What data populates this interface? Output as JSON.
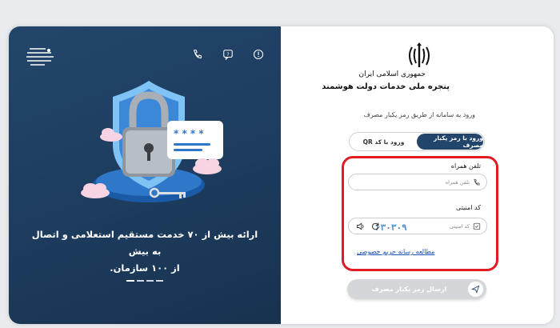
{
  "left_panel": {
    "tagline_line1": "ارائه بیش از ۷۰ خدمت مستقیم استعلامی و اتصال به بیش",
    "tagline_line2": "از ۱۰۰ سازمان.",
    "slider": {
      "slide_count": 4,
      "active_index": 0
    },
    "icons": [
      "info-icon",
      "chat-icon",
      "phone-icon",
      "globe-logo-icon"
    ]
  },
  "header": {
    "gov_name": "جمهوری اسلامی ایران",
    "portal_name": "پنجره ملی خدمات دولت هوشمند",
    "intro": "ورود به سامانه از طریق رمز یکبار مصرف"
  },
  "tabs": [
    {
      "label": "ورود با رمز یکبار مصرف",
      "active": true
    },
    {
      "label": "ورود با کد QR",
      "active": false
    }
  ],
  "form": {
    "phone_label": "تلفن همراه",
    "phone_placeholder": "تلفن همراه",
    "security_label": "کد امنیتی",
    "security_placeholder": "کد امنیتی",
    "captcha_text": "۶۳۰۳۰۹",
    "privacy_link": "مطالعه رسانه حریم خصوصی",
    "submit_label": "ارسال رمز یکبار مصرف"
  },
  "colors": {
    "primary": "#22466b",
    "highlight": "#e01b24",
    "link": "#1d50b8"
  }
}
